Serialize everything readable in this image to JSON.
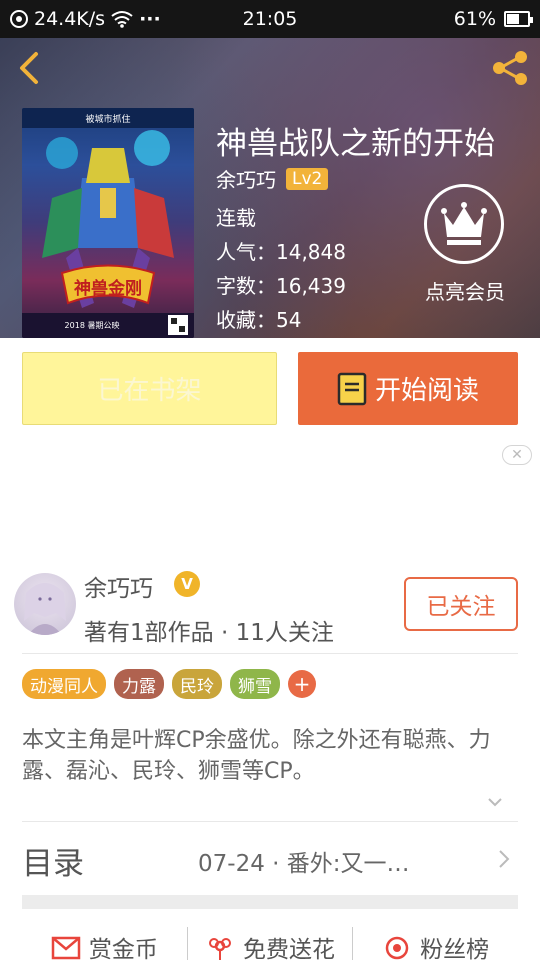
{
  "status_bar": {
    "speed": "24.4K/s",
    "dots": "···",
    "time": "21:05",
    "battery": "61%",
    "battery_level": 0.61
  },
  "header": {
    "book_title": "神兽战队之新的开始",
    "author": "余巧巧",
    "level": "Lv2",
    "status": "连载",
    "popularity": "人气：14,848",
    "word_count": "字数：16,439",
    "favorites": "收藏：54",
    "vip_label": "点亮会员",
    "cover_top_text": "被城市抓住",
    "cover_logo_text": "神兽金刚",
    "cover_bottom_text": "2018 暑期公映",
    "icons": {
      "back": "back-arrow-icon",
      "share": "share-icon",
      "vip": "crown-icon",
      "read": "book-icon"
    },
    "colors": {
      "icon_accent": "#f2b33a",
      "read_button": "#ea6a3b",
      "shelf_button": "#fff59a"
    }
  },
  "actions": {
    "shelf_label": "已在书架",
    "read_label": "开始阅读"
  },
  "ad": {
    "close_label": "✕"
  },
  "author_card": {
    "name": "余巧巧",
    "verified_mark": "V",
    "subtitle": "著有1部作品 · 11人关注",
    "follow_label": "已关注"
  },
  "tags": [
    {
      "label": "动漫同人",
      "color": "#f0a830"
    },
    {
      "label": "力露",
      "color": "#b0624f"
    },
    {
      "label": "民玲",
      "color": "#c9a53b"
    },
    {
      "label": "狮雪",
      "color": "#8fb64a"
    }
  ],
  "tag_more": "+",
  "description": "本文主角是叶辉CP余盛优。除之外还有聪燕、力露、磊沁、民玲、狮雪等CP。",
  "toc": {
    "title": "目录",
    "latest": "07-24 · 番外:又一…"
  },
  "bottom_bar": [
    {
      "label": "赏金币",
      "icon": "envelope-icon"
    },
    {
      "label": "免费送花",
      "icon": "flower-icon"
    },
    {
      "label": "粉丝榜",
      "icon": "fans-ranking-icon"
    }
  ]
}
